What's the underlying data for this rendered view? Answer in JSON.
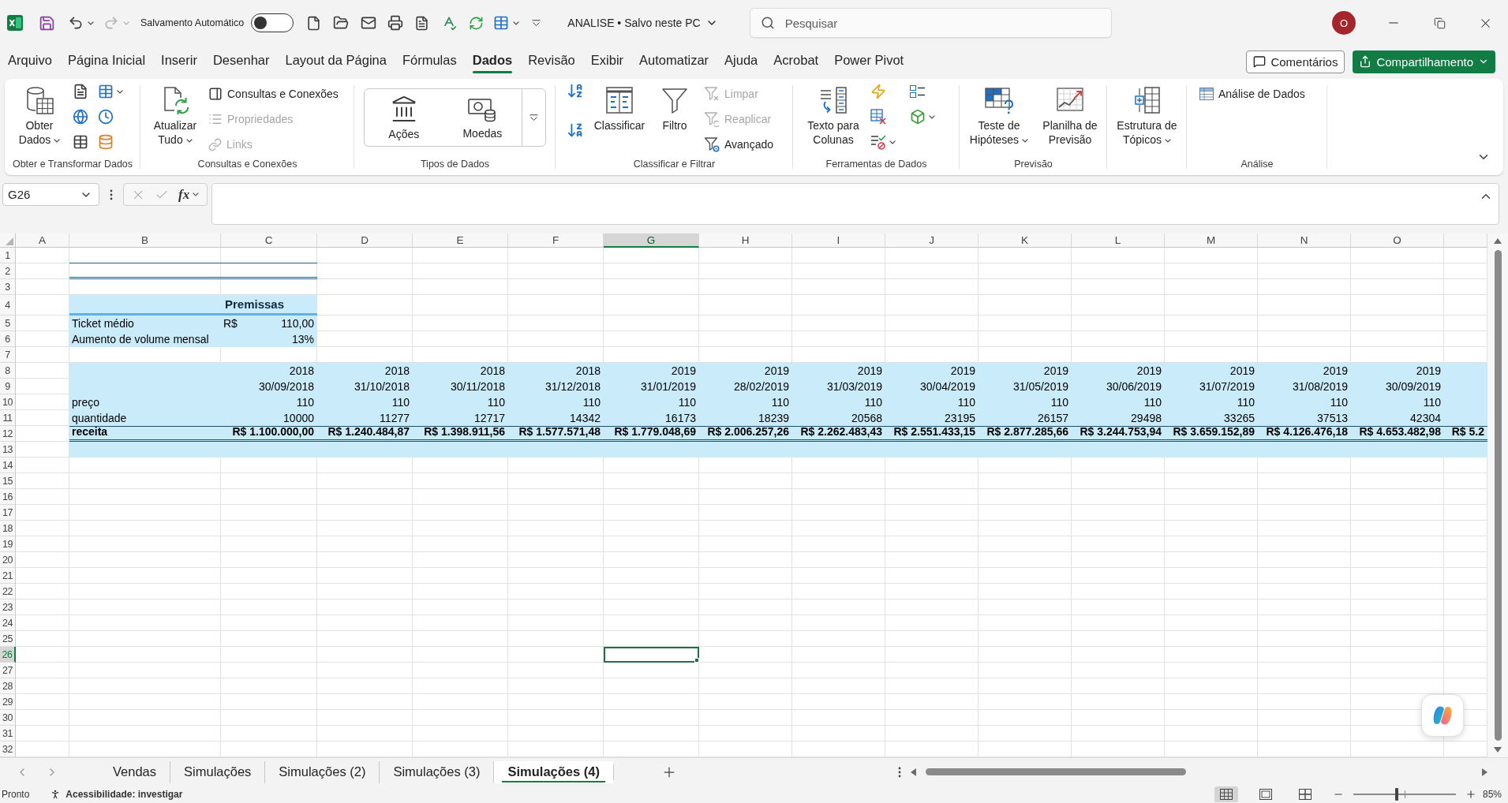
{
  "title_bar": {
    "undo": {
      "disabled": false
    },
    "redo": {
      "disabled": true
    },
    "autosave": {
      "label": "Salvamento Automático",
      "on": false
    },
    "document_title": "ANALISE • Salvo neste PC",
    "search": {
      "placeholder": "Pesquisar"
    },
    "account_initial": "O"
  },
  "menu_tabs": [
    {
      "label": "Arquivo",
      "selected": false
    },
    {
      "label": "Página Inicial",
      "selected": false
    },
    {
      "label": "Inserir",
      "selected": false
    },
    {
      "label": "Desenhar",
      "selected": false
    },
    {
      "label": "Layout da Página",
      "selected": false
    },
    {
      "label": "Fórmulas",
      "selected": false
    },
    {
      "label": "Dados",
      "selected": true
    },
    {
      "label": "Revisão",
      "selected": false
    },
    {
      "label": "Exibir",
      "selected": false
    },
    {
      "label": "Automatizar",
      "selected": false
    },
    {
      "label": "Ajuda",
      "selected": false
    },
    {
      "label": "Acrobat",
      "selected": false
    },
    {
      "label": "Power Pivot",
      "selected": false
    }
  ],
  "comments_button": "Comentários",
  "share_button": "Compartilhamento",
  "ribbon": {
    "groups": [
      {
        "label": "Obter e Transformar Dados",
        "items": [
          {
            "kind": "large",
            "label": "Obter Dados",
            "dropdown": true
          }
        ]
      },
      {
        "label": "Consultas e Conexões",
        "items": [
          {
            "kind": "large",
            "label": "Atualizar Tudo",
            "dropdown": true
          },
          {
            "kind": "small",
            "label": "Consultas e Conexões",
            "disabled": false
          },
          {
            "kind": "small",
            "label": "Propriedades",
            "disabled": true
          },
          {
            "kind": "small",
            "label": "Links",
            "disabled": true
          }
        ]
      },
      {
        "label": "Tipos de Dados",
        "items": [
          {
            "kind": "gallery",
            "label": "Ações"
          },
          {
            "kind": "gallery",
            "label": "Moedas"
          }
        ]
      },
      {
        "label": "Classificar e Filtrar",
        "items": [
          {
            "kind": "large",
            "label": "Classificar",
            "dropdown": false
          },
          {
            "kind": "large",
            "label": "Filtro",
            "dropdown": false
          },
          {
            "kind": "small",
            "label": "Limpar",
            "disabled": true
          },
          {
            "kind": "small",
            "label": "Reaplicar",
            "disabled": true
          },
          {
            "kind": "small",
            "label": "Avançado",
            "disabled": false
          }
        ]
      },
      {
        "label": "Ferramentas de Dados",
        "items": [
          {
            "kind": "large",
            "label": "Texto para Colunas",
            "dropdown": false
          }
        ]
      },
      {
        "label": "Previsão",
        "items": [
          {
            "kind": "large",
            "label": "Teste de Hipóteses",
            "dropdown": true
          },
          {
            "kind": "large",
            "label": "Planilha de Previsão",
            "dropdown": false
          }
        ]
      },
      {
        "items": [
          {
            "kind": "large",
            "label": "Estrutura de Tópicos",
            "dropdown": true
          }
        ]
      },
      {
        "label": "Análise",
        "items": [
          {
            "kind": "small",
            "label": "Análise de Dados",
            "disabled": false
          }
        ]
      }
    ]
  },
  "formula_bar": {
    "name_box": "G26",
    "function_label": "fx"
  },
  "sheet": {
    "columns": [
      {
        "label": "A",
        "selected": false
      },
      {
        "label": "B",
        "selected": false
      },
      {
        "label": "C",
        "selected": false
      },
      {
        "label": "D",
        "selected": false
      },
      {
        "label": "E",
        "selected": false
      },
      {
        "label": "F",
        "selected": false
      },
      {
        "label": "G",
        "selected": true
      },
      {
        "label": "H",
        "selected": false
      },
      {
        "label": "I",
        "selected": false
      },
      {
        "label": "J",
        "selected": false
      },
      {
        "label": "K",
        "selected": false
      },
      {
        "label": "L",
        "selected": false
      },
      {
        "label": "M",
        "selected": false
      },
      {
        "label": "N",
        "selected": false
      },
      {
        "label": "O",
        "selected": false
      }
    ],
    "row_numbers": [
      {
        "label": "1",
        "selected": false
      },
      {
        "label": "2",
        "selected": false
      },
      {
        "label": "3",
        "selected": false
      },
      {
        "label": "4",
        "selected": false
      },
      {
        "label": "5",
        "selected": false
      },
      {
        "label": "6",
        "selected": false
      },
      {
        "label": "7",
        "selected": false
      },
      {
        "label": "8",
        "selected": false
      },
      {
        "label": "9",
        "selected": false
      },
      {
        "label": "10",
        "selected": false
      },
      {
        "label": "11",
        "selected": false
      },
      {
        "label": "12",
        "selected": false
      },
      {
        "label": "13",
        "selected": false
      },
      {
        "label": "14",
        "selected": false
      },
      {
        "label": "15",
        "selected": false
      },
      {
        "label": "16",
        "selected": false
      },
      {
        "label": "17",
        "selected": false
      },
      {
        "label": "18",
        "selected": false
      },
      {
        "label": "19",
        "selected": false
      },
      {
        "label": "20",
        "selected": false
      },
      {
        "label": "21",
        "selected": false
      },
      {
        "label": "22",
        "selected": false
      },
      {
        "label": "23",
        "selected": false
      },
      {
        "label": "24",
        "selected": false
      },
      {
        "label": "25",
        "selected": false
      },
      {
        "label": "26",
        "selected": true
      },
      {
        "label": "27",
        "selected": false
      },
      {
        "label": "28",
        "selected": false
      },
      {
        "label": "29",
        "selected": false
      },
      {
        "label": "30",
        "selected": false
      },
      {
        "label": "31",
        "selected": false
      },
      {
        "label": "32",
        "selected": false
      }
    ],
    "premissas": {
      "title": "Premissas",
      "rows": [
        {
          "label": "Ticket médio",
          "currency": "R$",
          "value": "110,00"
        },
        {
          "label": "Aumento de volume mensal",
          "value": "13%"
        }
      ]
    },
    "projection": {
      "years": [
        "2018",
        "2018",
        "2018",
        "2018",
        "2019",
        "2019",
        "2019",
        "2019",
        "2019",
        "2019",
        "2019",
        "2019",
        "2019"
      ],
      "dates": [
        "30/09/2018",
        "31/10/2018",
        "30/11/2018",
        "31/12/2018",
        "31/01/2019",
        "28/02/2019",
        "31/03/2019",
        "30/04/2019",
        "31/05/2019",
        "30/06/2019",
        "31/07/2019",
        "31/08/2019",
        "30/09/2019"
      ],
      "rows": [
        {
          "kind": "plain",
          "label": "preço",
          "values": [
            "110",
            "110",
            "110",
            "110",
            "110",
            "110",
            "110",
            "110",
            "110",
            "110",
            "110",
            "110",
            "110"
          ]
        },
        {
          "kind": "plain",
          "label": "quantidade",
          "values": [
            "10000",
            "11277",
            "12717",
            "14342",
            "16173",
            "18239",
            "20568",
            "23195",
            "26157",
            "29498",
            "33265",
            "37513",
            "42304"
          ]
        },
        {
          "kind": "total",
          "label": "receita",
          "values": [
            "R$ 1.100.000,00",
            "R$ 1.240.484,87",
            "R$ 1.398.911,56",
            "R$ 1.577.571,48",
            "R$ 1.779.048,69",
            "R$ 2.006.257,26",
            "R$ 2.262.483,43",
            "R$ 2.551.433,15",
            "R$ 2.877.285,66",
            "R$ 3.244.753,94",
            "R$ 3.659.152,89",
            "R$ 4.126.476,18",
            "R$ 4.653.482,98",
            "R$ 5.2"
          ]
        }
      ]
    }
  },
  "sheet_tabs": [
    {
      "label": "Vendas",
      "selected": false
    },
    {
      "label": "Simulações",
      "selected": false
    },
    {
      "label": "Simulações (2)",
      "selected": false
    },
    {
      "label": "Simulações (3)",
      "selected": false
    },
    {
      "label": "Simulações (4)",
      "selected": true
    }
  ],
  "status_bar": {
    "status": "Pronto",
    "accessibility": "Acessibilidade: investigar",
    "views": [
      {
        "selected": true
      },
      {
        "selected": false
      },
      {
        "selected": false
      }
    ],
    "zoom_slider": {
      "level": 0.42
    },
    "zoom": "85%"
  }
}
